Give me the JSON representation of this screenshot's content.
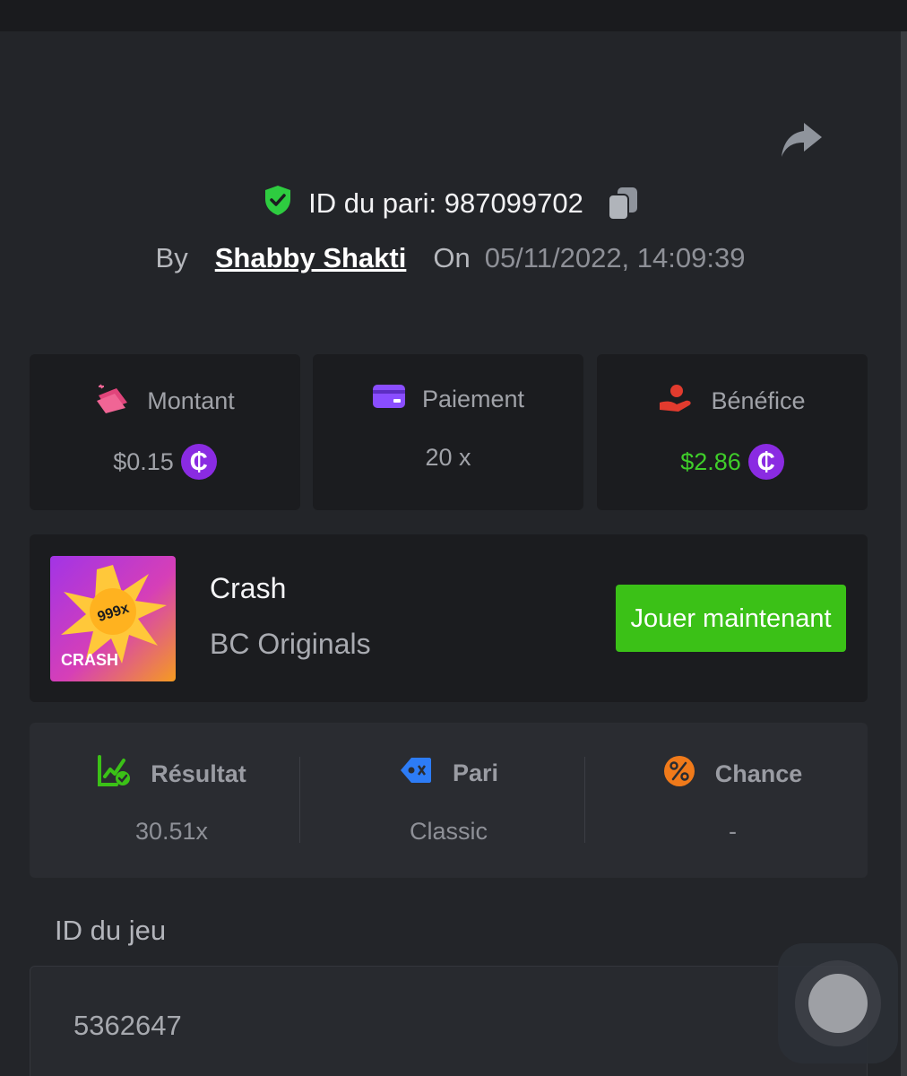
{
  "bet": {
    "id_label": "ID du pari: 987099702",
    "by_label": "By",
    "user": "Shabby Shakti",
    "on_label": "On",
    "datetime": "05/11/2022, 14:09:39"
  },
  "stats": [
    {
      "label": "Montant",
      "value": "$0.15",
      "icon": "money-icon",
      "currency": "₵",
      "value_color": "#a0a2a8"
    },
    {
      "label": "Paiement",
      "value": "20 x",
      "icon": "card-icon"
    },
    {
      "label": "Bénéfice",
      "value": "$2.86",
      "icon": "profit-hand-icon",
      "currency": "₵",
      "value_color": "#3fce2a"
    }
  ],
  "game": {
    "name": "Crash",
    "provider": "BC Originals",
    "thumb_badge": "999x",
    "thumb_title": "CRASH",
    "play_button": "Jouer maintenant"
  },
  "details": [
    {
      "label": "Résultat",
      "value": "30.51x",
      "icon": "chart-check-icon"
    },
    {
      "label": "Pari",
      "value": "Classic",
      "icon": "tag-icon"
    },
    {
      "label": "Chance",
      "value": "-",
      "icon": "percent-icon"
    }
  ],
  "game_id": {
    "label": "ID du jeu",
    "value": "5362647"
  },
  "colors": {
    "accent_green": "#3bc117",
    "coin_purple": "#8a2be2",
    "shield_green": "#2ecc40"
  }
}
